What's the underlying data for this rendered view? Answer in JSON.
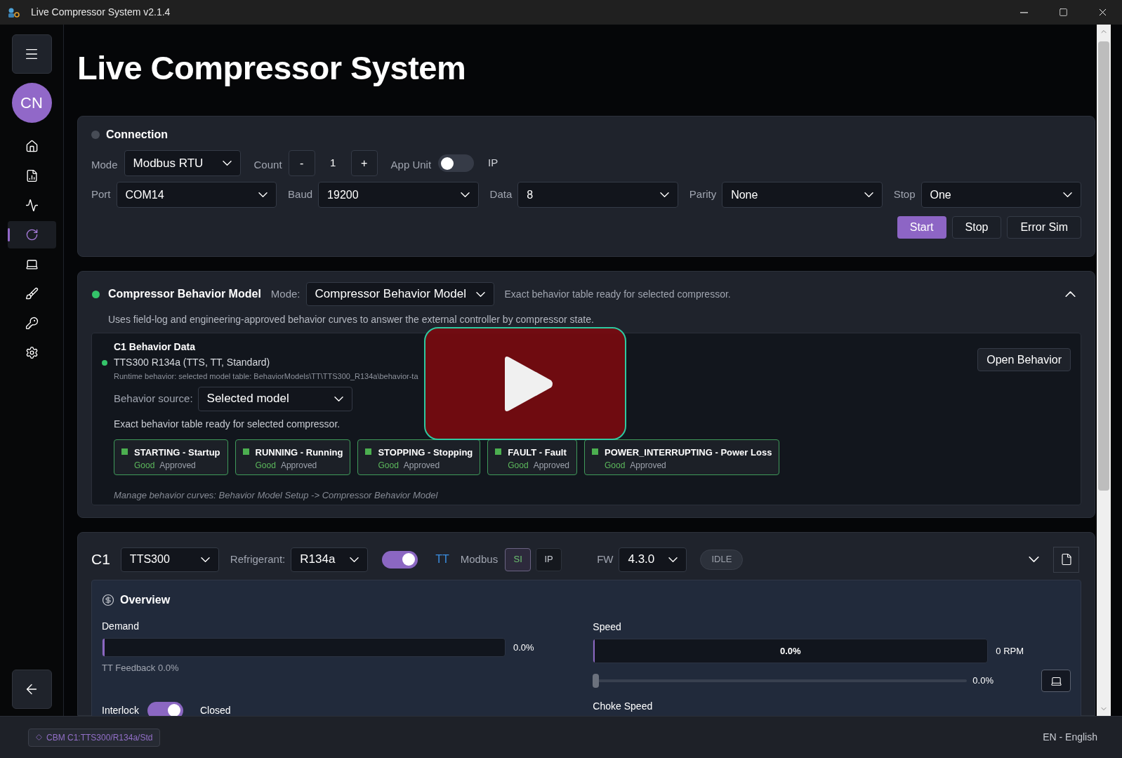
{
  "window": {
    "title": "Live Compressor System v2.1.4"
  },
  "sidebar": {
    "avatar": "CN",
    "nav_items": [
      {
        "selected": false
      },
      {
        "selected": false
      },
      {
        "selected": false
      },
      {
        "selected": true
      },
      {
        "selected": false
      },
      {
        "selected": false
      },
      {
        "selected": false
      },
      {
        "selected": false
      }
    ]
  },
  "page_title": "Live Compressor System",
  "connection": {
    "title": "Connection",
    "connected": false,
    "mode": {
      "label": "Mode",
      "value": "Modbus RTU"
    },
    "count": {
      "label": "Count",
      "decrement": "-",
      "value": "1",
      "increment": "+"
    },
    "app_unit": {
      "label": "App Unit",
      "on": false
    },
    "ip_label": "IP",
    "serial_fields": [
      {
        "label": "Port",
        "value": "COM14"
      },
      {
        "label": "Baud",
        "value": "19200"
      },
      {
        "label": "Data",
        "value": "8"
      },
      {
        "label": "Parity",
        "value": "None"
      },
      {
        "label": "Stop",
        "value": "One"
      }
    ],
    "buttons": [
      {
        "label": "Start",
        "kind": "primary"
      },
      {
        "label": "Stop",
        "kind": "secondary"
      },
      {
        "label": "Error Sim",
        "kind": "secondary"
      }
    ]
  },
  "behavior_model": {
    "title": "Compressor Behavior Model",
    "active": true,
    "mode_label": "Mode:",
    "mode_value": "Compressor Behavior Model",
    "status": "Exact behavior table ready for selected compressor.",
    "expanded": true,
    "description": "Uses field-log and engineering-approved behavior curves to answer the external controller by compressor state.",
    "data": {
      "title": "C1 Behavior Data",
      "ready": true,
      "model": "TTS300 R134a (TTS, TT, Standard)",
      "runtime": "Runtime behavior: selected model table: BehaviorModels\\TT\\TTS300_R134a\\behavior-ta",
      "source_label": "Behavior source:",
      "source_value": "Selected model",
      "ready_text": "Exact behavior table ready for selected compressor.",
      "open_button": "Open Behavior",
      "states": [
        {
          "name": "STARTING - Startup",
          "quality": "Good",
          "approval": "Approved"
        },
        {
          "name": "RUNNING - Running",
          "quality": "Good",
          "approval": "Approved"
        },
        {
          "name": "STOPPING - Stopping",
          "quality": "Good",
          "approval": "Approved"
        },
        {
          "name": "FAULT - Fault",
          "quality": "Good",
          "approval": "Approved"
        },
        {
          "name": "POWER_INTERRUPTING - Power Loss",
          "quality": "Good",
          "approval": "Approved"
        }
      ],
      "footer": "Manage behavior curves: Behavior Model Setup -> Compressor Behavior Model"
    }
  },
  "compressor": {
    "label": "C1",
    "model": "TTS300",
    "refrigerant_label": "Refrigerant:",
    "refrigerant": "R134a",
    "enabled": true,
    "type": "TT",
    "modbus_label": "Modbus",
    "units": [
      {
        "label": "SI",
        "selected": true
      },
      {
        "label": "IP",
        "selected": false
      }
    ],
    "fw_label": "FW",
    "fw": "4.3.0",
    "status": "IDLE",
    "expanded": false,
    "overview": {
      "title": "Overview",
      "demand_label": "Demand",
      "demand": {
        "level": 0
      },
      "demand_reading": "0.0%",
      "feedback": "TT Feedback 0.0%",
      "interlock_label": "Interlock",
      "interlock_on": true,
      "interlock_state": "Closed",
      "speed_label": "Speed",
      "speed": {
        "level": 0
      },
      "speed_bar_text": "0.0%",
      "speed_rpm": "0 RPM",
      "speed_slider": {
        "level": 0
      },
      "speed_slider_reading": "0.0%",
      "choke_label": "Choke Speed"
    }
  },
  "status_bar": {
    "profile": "CBM C1:TTS300/R134a/Std",
    "language": "EN - English"
  }
}
